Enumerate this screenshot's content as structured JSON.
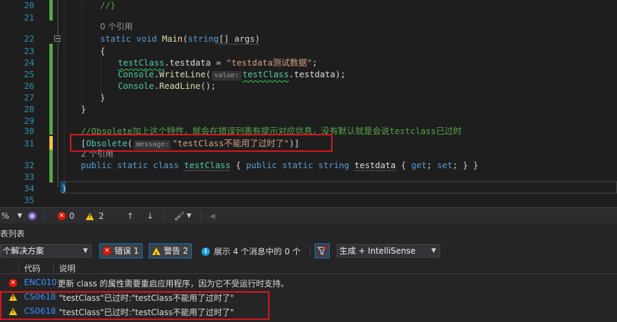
{
  "editor": {
    "line_numbers": [
      "20",
      "21",
      "",
      "22",
      "23",
      "24",
      "25",
      "26",
      "27",
      "28",
      "29",
      "30",
      "31",
      "",
      "32",
      "33",
      "34",
      "35"
    ],
    "line20": "//}",
    "refs0": "0 个引用",
    "main_static": "static",
    "main_void": "void",
    "main_name": "Main",
    "main_paren_open": "(",
    "main_string": "string",
    "main_args_tail": "[] args)",
    "brace_open": "{",
    "l24_cls": "testClass",
    "l24_mid": ".testdata = ",
    "l24_str": "\"testdata测试数据\"",
    "l24_end": ";",
    "l25_console": "Console",
    "l25_dot": ".",
    "l25_method": "WriteLine",
    "l25_paren": "(",
    "l25_hint": "value:",
    "l25_cls": "testClass",
    "l25_tail": ".testdata);",
    "l26_console": "Console",
    "l26_dot": ".",
    "l26_method": "ReadLine",
    "l26_tail": "();",
    "brace_close_inner": "}",
    "brace_close_outer": "}",
    "comment": "//Obsolete加上这个特性，就会在错误列表有提示对应信息，没有默认就是会说testclass已过时",
    "attr_open": "[",
    "attr_name": "Obsolete",
    "attr_paren": "(",
    "attr_hint": "message:",
    "attr_str": "\"testClass不能用了过时了\"",
    "attr_close": ")]",
    "refs2": "2 个引用",
    "l32_public": "public",
    "l32_static": "static",
    "l32_class": "class",
    "l32_name": "testClass",
    "l32_brace": "{",
    "l32_public2": "public",
    "l32_static2": "static",
    "l32_string": "string",
    "l32_prop": "testdata",
    "l32_body": "{",
    "l32_get": "get",
    "l32_set": "set",
    "l32_semi1": ";",
    "l32_semi2": ";",
    "l32_end": "} }",
    "l34_brace": "}"
  },
  "status_bar": {
    "zoom": "%",
    "errors": "0",
    "warnings": "2"
  },
  "error_list": {
    "title": "表列表",
    "scope": "个解决方案",
    "errors_label": "错误 1",
    "warnings_label": "警告 2",
    "messages_label": "展示 4 个消息中的 0 个",
    "build_filter": "生成 + IntelliSense",
    "col_code": "代码",
    "col_desc": "说明",
    "rows": [
      {
        "type": "error",
        "code": "ENC010",
        "desc": "更新 class 的属性需要重启应用程序，因为它不受运行时支持。"
      },
      {
        "type": "warning",
        "code": "CS0618",
        "desc": "\"testClass\"已过时:\"testClass不能用了过时了\""
      },
      {
        "type": "warning",
        "code": "CS0618",
        "desc": "\"testClass\"已过时:\"testClass不能用了过时了\""
      }
    ]
  },
  "colors": {
    "accent": "#007acc",
    "highlight_box": "#e1141e",
    "error": "#e51400",
    "warning": "#f2c811"
  }
}
